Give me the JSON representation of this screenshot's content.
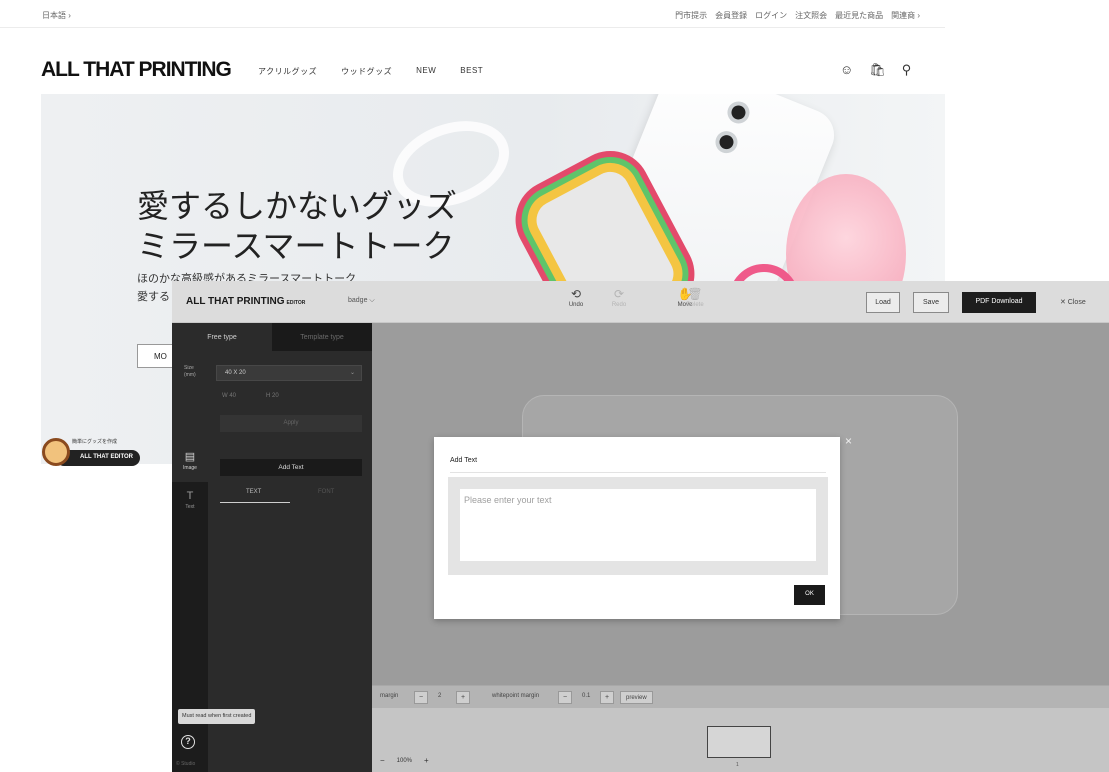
{
  "site": {
    "language": "日本語 ›",
    "top_links": [
      "門市提示",
      "会員登録",
      "ログイン",
      "注文照会",
      "最近見た商品",
      "関連商 ›"
    ],
    "logo": "ALL THAT PRINTING",
    "nav": [
      "アクリルグッズ",
      "ウッドグッズ",
      "NEW",
      "BEST"
    ],
    "hero": {
      "title_line1": "愛するしかないグッズ",
      "title_line2": "ミラースマートトーク",
      "desc_line1": "ほのかな高級感があるミラースマートトーク",
      "desc_line2": "愛する",
      "more_label": "MO"
    },
    "editor_badge": {
      "small_text": "簡単にグッズを作成",
      "label": "ALL THAT EDITOR"
    }
  },
  "editor": {
    "logo": "ALL THAT PRINTING",
    "logo_suffix": "EDITOR",
    "product": "badge ⌵",
    "tools": [
      {
        "icon": "⟲",
        "label": "Undo"
      },
      {
        "icon": "⟳",
        "label": "Redo"
      },
      {
        "icon": "✋",
        "label": "Move"
      },
      {
        "icon": "🗑",
        "label": "Delete"
      }
    ],
    "load_label": "Load",
    "save_label": "Save",
    "pdf_label": "PDF Download",
    "close_label": "✕ Close",
    "tabs": {
      "free": "Free type",
      "template": "Template type"
    },
    "size_label_1": "Size",
    "size_label_2": "(mm)",
    "size_value": "40 X 20",
    "dims_w": "W  40",
    "dims_h": "H  20",
    "apply_label": "Apply",
    "rail": {
      "image": "Image",
      "text": "Text"
    },
    "add_text_label": "Add Text",
    "sub_tabs": {
      "text": "TEXT",
      "font": "FONT"
    },
    "must_read": "Must read when first created",
    "side_footer": "© Studio",
    "bottom": {
      "margin_label": "margin",
      "margin_value": "2",
      "ws_label": "whitepoint margin",
      "ws_value": "0.1",
      "preview_label": "preview"
    },
    "zoom": {
      "minus": "−",
      "value": "100%",
      "plus": "+"
    },
    "page_number": "1"
  },
  "modal": {
    "title": "Add Text",
    "placeholder": "Please enter your text",
    "ok_label": "OK",
    "close_icon": "×"
  }
}
